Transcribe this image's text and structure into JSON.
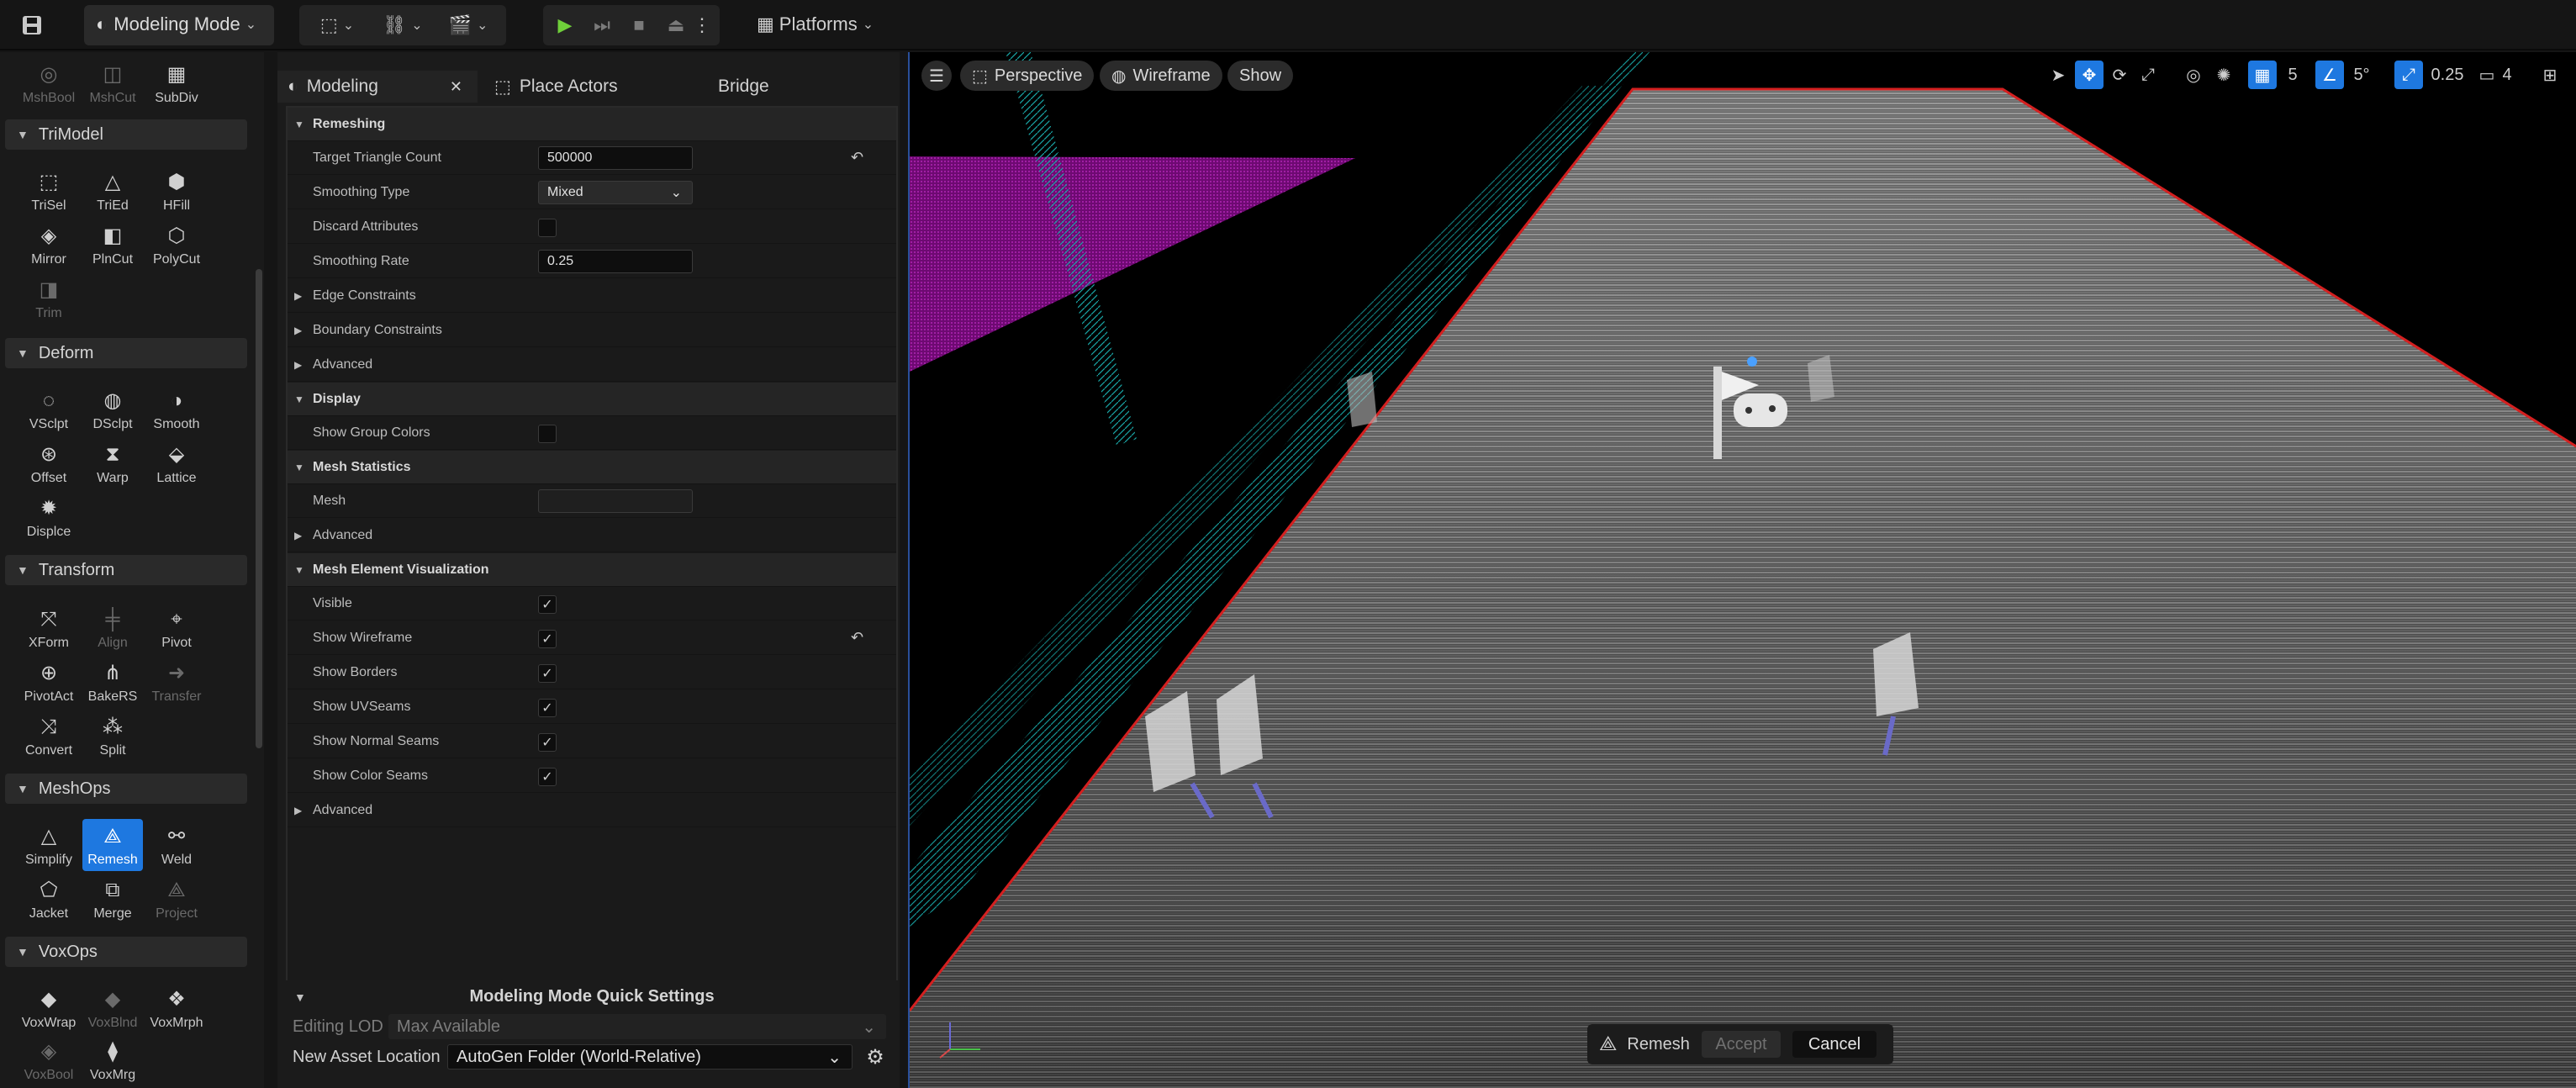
{
  "toolbar": {
    "mode_label": "Modeling Mode",
    "platforms_label": "Platforms"
  },
  "palette": {
    "top_row": [
      {
        "label": "MshBool",
        "icon": "mesh-boolean-icon",
        "disabled": true
      },
      {
        "label": "MshCut",
        "icon": "mesh-cut-icon",
        "disabled": true
      },
      {
        "label": "SubDiv",
        "icon": "subdivide-icon",
        "disabled": false
      }
    ],
    "sections": [
      {
        "title": "TriModel",
        "tools": [
          {
            "label": "TriSel",
            "icon": "triangle-select-icon"
          },
          {
            "label": "TriEd",
            "icon": "triangle-edit-icon"
          },
          {
            "label": "HFill",
            "icon": "hole-fill-icon"
          },
          {
            "label": "Mirror",
            "icon": "mirror-icon"
          },
          {
            "label": "PlnCut",
            "icon": "plane-cut-icon"
          },
          {
            "label": "PolyCut",
            "icon": "poly-cut-icon"
          },
          {
            "label": "Trim",
            "icon": "trim-icon",
            "disabled": true
          }
        ]
      },
      {
        "title": "Deform",
        "tools": [
          {
            "label": "VSclpt",
            "icon": "vertex-sculpt-icon"
          },
          {
            "label": "DSclpt",
            "icon": "dynamic-sculpt-icon"
          },
          {
            "label": "Smooth",
            "icon": "smooth-icon"
          },
          {
            "label": "Offset",
            "icon": "offset-icon"
          },
          {
            "label": "Warp",
            "icon": "warp-icon"
          },
          {
            "label": "Lattice",
            "icon": "lattice-icon"
          },
          {
            "label": "Displce",
            "icon": "displace-icon"
          }
        ]
      },
      {
        "title": "Transform",
        "tools": [
          {
            "label": "XForm",
            "icon": "xform-icon"
          },
          {
            "label": "Align",
            "icon": "align-icon",
            "disabled": true
          },
          {
            "label": "Pivot",
            "icon": "pivot-icon"
          },
          {
            "label": "PivotAct",
            "icon": "pivot-actor-icon"
          },
          {
            "label": "BakeRS",
            "icon": "bake-rs-icon"
          },
          {
            "label": "Transfer",
            "icon": "transfer-icon",
            "disabled": true
          },
          {
            "label": "Convert",
            "icon": "convert-icon"
          },
          {
            "label": "Split",
            "icon": "split-icon"
          }
        ]
      },
      {
        "title": "MeshOps",
        "tools": [
          {
            "label": "Simplify",
            "icon": "simplify-icon"
          },
          {
            "label": "Remesh",
            "icon": "remesh-icon",
            "selected": true
          },
          {
            "label": "Weld",
            "icon": "weld-icon"
          },
          {
            "label": "Jacket",
            "icon": "jacket-icon"
          },
          {
            "label": "Merge",
            "icon": "merge-icon"
          },
          {
            "label": "Project",
            "icon": "project-icon",
            "disabled": true
          }
        ]
      },
      {
        "title": "VoxOps",
        "tools": [
          {
            "label": "VoxWrap",
            "icon": "voxel-wrap-icon"
          },
          {
            "label": "VoxBlnd",
            "icon": "voxel-blend-icon",
            "disabled": true
          },
          {
            "label": "VoxMrph",
            "icon": "voxel-morph-icon"
          },
          {
            "label": "VoxBool",
            "icon": "voxel-boolean-icon",
            "disabled": true
          },
          {
            "label": "VoxMrg",
            "icon": "voxel-merge-icon"
          }
        ]
      }
    ]
  },
  "tabs": {
    "modeling": "Modeling",
    "place_actors": "Place Actors",
    "bridge": "Bridge"
  },
  "details": {
    "remeshing": "Remeshing",
    "target_triangle_count_label": "Target Triangle Count",
    "target_triangle_count_value": "500000",
    "smoothing_type_label": "Smoothing Type",
    "smoothing_type_value": "Mixed",
    "discard_attributes_label": "Discard Attributes",
    "smoothing_rate_label": "Smoothing Rate",
    "smoothing_rate_value": "0.25",
    "edge_constraints": "Edge Constraints",
    "boundary_constraints": "Boundary Constraints",
    "advanced": "Advanced",
    "display": "Display",
    "show_group_colors_label": "Show Group Colors",
    "mesh_statistics": "Mesh Statistics",
    "mesh_label": "Mesh",
    "mesh_element_visualization": "Mesh Element Visualization",
    "visible_label": "Visible",
    "show_wireframe_label": "Show Wireframe",
    "show_borders_label": "Show Borders",
    "show_uvseams_label": "Show UVSeams",
    "show_normal_seams_label": "Show Normal Seams",
    "show_color_seams_label": "Show Color Seams"
  },
  "quick_settings": {
    "title": "Modeling Mode Quick Settings",
    "editing_lod_label": "Editing LOD",
    "editing_lod_value": "Max Available",
    "asset_location_label": "New Asset Location",
    "asset_location_value": "AutoGen Folder (World-Relative)"
  },
  "viewport": {
    "perspective": "Perspective",
    "wireframe": "Wireframe",
    "show": "Show",
    "grid_snap": "5",
    "angle_snap": "5°",
    "scale_snap": "0.25",
    "camera_speed": "4",
    "remesh_label": "Remesh",
    "accept_label": "Accept",
    "cancel_label": "Cancel"
  },
  "colors": {
    "accent": "#1e78e0",
    "wire_cyan": "#1aa8a8",
    "magenta": "#8e0e92",
    "border_red": "#d42020"
  }
}
